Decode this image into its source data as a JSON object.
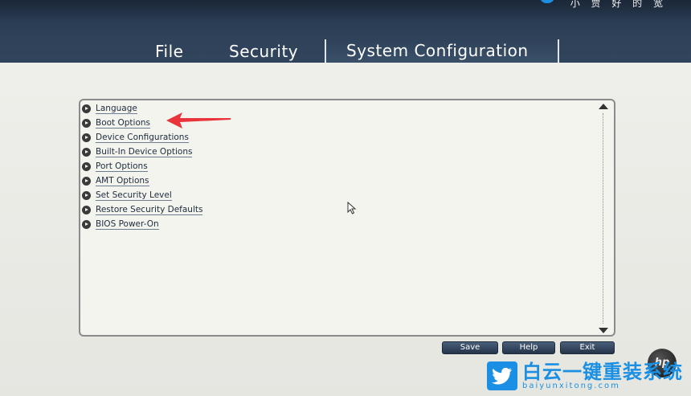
{
  "watermark_top": "小 贾 好 的 宽",
  "menu": {
    "file": "File",
    "security": "Security",
    "system_configuration": "System Configuration"
  },
  "options": [
    "Language",
    "Boot Options",
    "Device Configurations",
    "Built-In Device Options",
    "Port Options",
    "AMT Options",
    "Set Security Level",
    "Restore Security Defaults",
    "BIOS Power-On"
  ],
  "buttons": {
    "save": "Save",
    "help": "Help",
    "exit": "Exit"
  },
  "logo": "hp",
  "watermark": {
    "main": "白云一键重装系统",
    "sub": "baiyunxitong.com"
  },
  "colors": {
    "header": "#2f425a",
    "panel": "#f4f4ee",
    "link_text": "#1d2b3e",
    "annotation_arrow": "#e8343a",
    "watermark": "#1a8fe3"
  }
}
